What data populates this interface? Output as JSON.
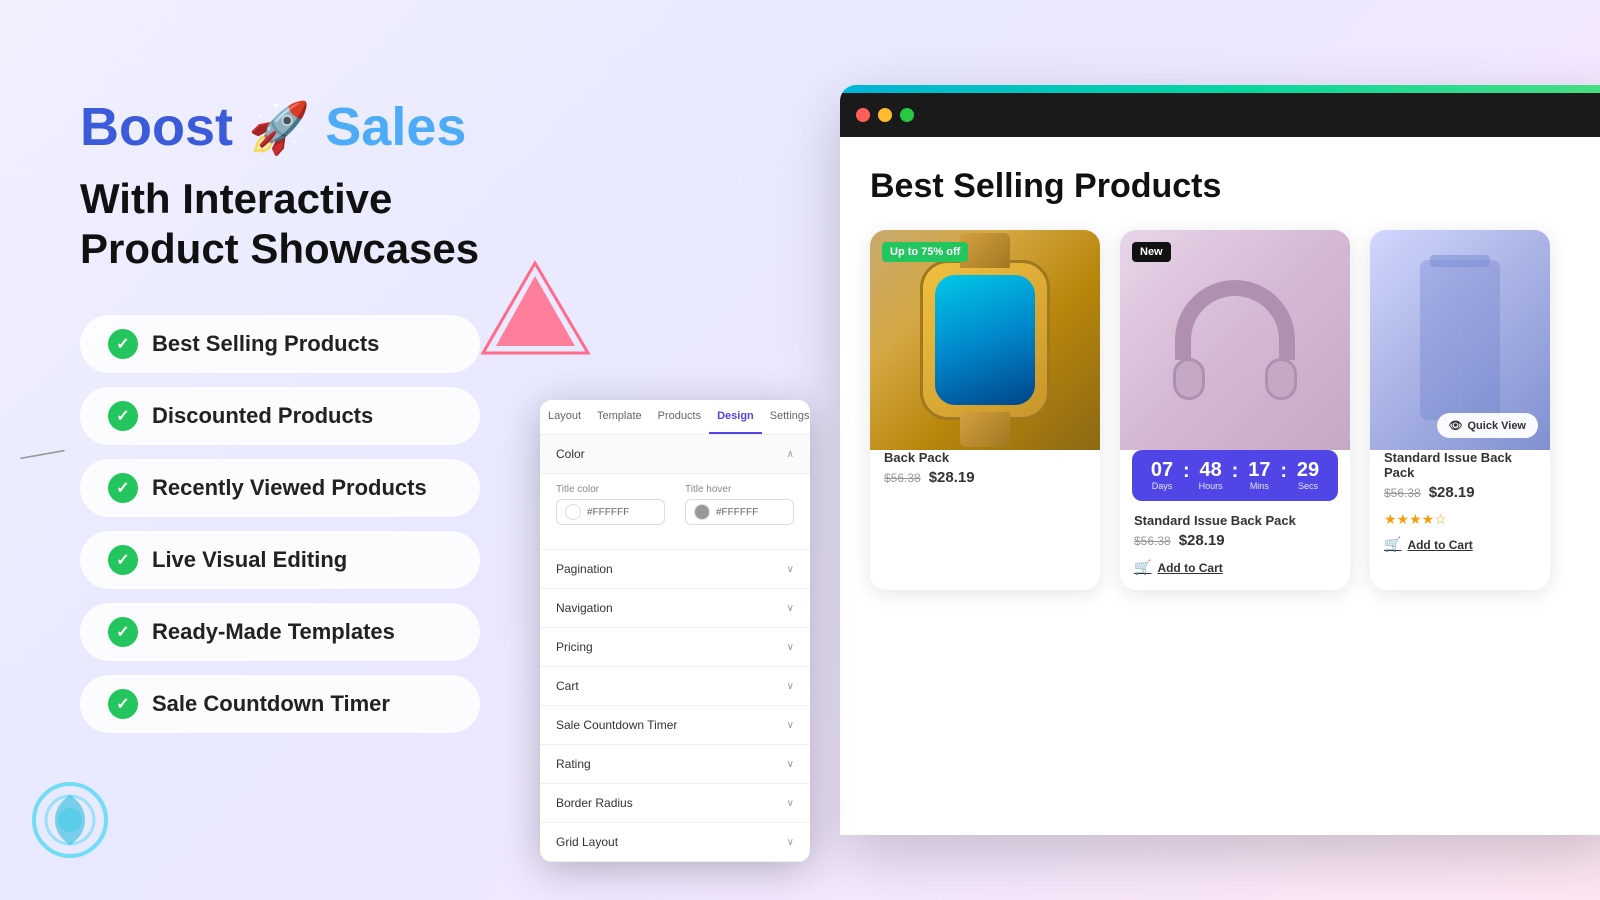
{
  "logo": {
    "boost": "Boost",
    "rocket": "🚀",
    "sales": "Sales"
  },
  "tagline": "With Interactive\nProduct Showcases",
  "features": [
    {
      "id": "best-selling",
      "label": "Best Selling Products"
    },
    {
      "id": "discounted",
      "label": "Discounted Products"
    },
    {
      "id": "recently-viewed",
      "label": "Recently Viewed Products"
    },
    {
      "id": "live-visual",
      "label": "Live Visual Editing"
    },
    {
      "id": "ready-made",
      "label": "Ready-Made Templates"
    },
    {
      "id": "sale-countdown",
      "label": "Sale Countdown Timer"
    }
  ],
  "browser": {
    "section_title": "Best Selling Products",
    "badge_sale": "Up to 75% off",
    "badge_new": "New",
    "quick_view": "Quick View",
    "products": [
      {
        "name": "Back Pack",
        "original_price": "$56.38",
        "sale_price": "$28.19",
        "type": "watch"
      },
      {
        "name": "Standard Issue Back Pack",
        "original_price": "$56.38",
        "sale_price": "$28.19",
        "type": "headphones",
        "countdown": {
          "days": "07",
          "hours": "48",
          "mins": "17",
          "secs": "29"
        }
      },
      {
        "name": "Standard Issue Back Pack",
        "original_price": "$56.38",
        "sale_price": "$28.19",
        "type": "blue"
      }
    ],
    "add_to_cart": "Add to Cart"
  },
  "panel": {
    "tabs": [
      "Layout",
      "Template",
      "Products",
      "Design",
      "Settings"
    ],
    "active_tab": "Design",
    "sections": [
      {
        "label": "Color",
        "expanded": true
      },
      {
        "label": "Pagination",
        "expanded": false
      },
      {
        "label": "Navigation",
        "expanded": false
      },
      {
        "label": "Pricing",
        "expanded": false
      },
      {
        "label": "Cart",
        "expanded": false
      },
      {
        "label": "Sale Countdown Timer",
        "expanded": false
      },
      {
        "label": "Rating",
        "expanded": false
      },
      {
        "label": "Border Radius",
        "expanded": false
      },
      {
        "label": "Grid Layout",
        "expanded": false
      }
    ],
    "color_fields": {
      "title_color_label": "Title color",
      "title_color_value": "#FFFFFF",
      "title_hover_label": "Title hover",
      "title_hover_value": "#FFFFFF"
    }
  },
  "countdown": {
    "days_label": "Days",
    "hours_label": "Hours",
    "mins_label": "Mins",
    "secs_label": "Secs",
    "days_val": "07",
    "hours_val": "48",
    "mins_val": "17",
    "secs_val": "29"
  }
}
